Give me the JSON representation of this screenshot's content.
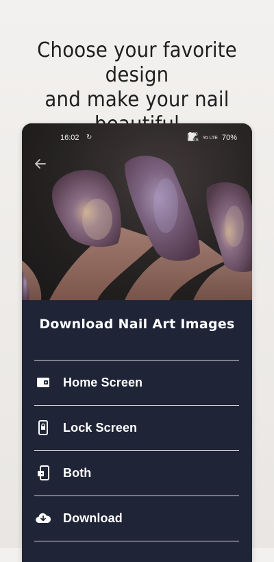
{
  "promo": {
    "line1": "Choose your favorite design",
    "line2": "and make your nail beautiful"
  },
  "status_bar": {
    "time": "16:02",
    "sync_icon": "sync-icon",
    "speed_value": "0.80",
    "speed_unit": "KB/S",
    "network_label": "Yo LTE",
    "battery": "70%"
  },
  "screen": {
    "back_icon": "arrow-left-icon",
    "title": "Download Nail Art Images"
  },
  "options": [
    {
      "label": "Home Screen",
      "icon": "home-screen-icon"
    },
    {
      "label": "Lock Screen",
      "icon": "lock-screen-icon"
    },
    {
      "label": "Both",
      "icon": "both-screens-icon"
    },
    {
      "label": "Download",
      "icon": "cloud-download-icon"
    }
  ],
  "colors": {
    "page_bg": "#f3f1ef",
    "panel_bg": "#1f2437",
    "divider": "#d9d9d9",
    "text_light": "#ffffff"
  }
}
